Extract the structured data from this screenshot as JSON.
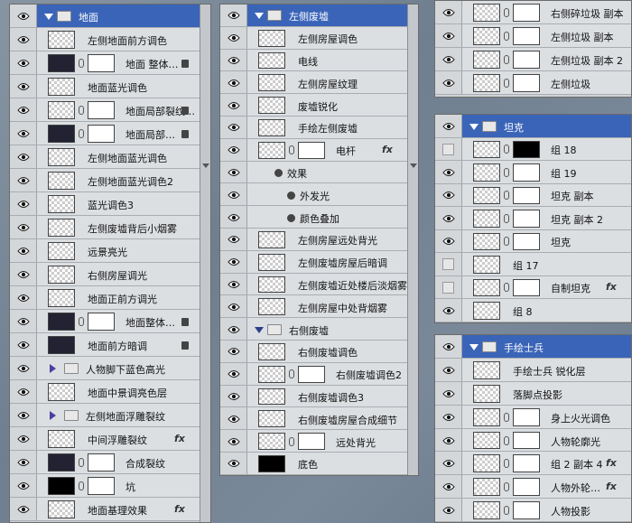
{
  "panel1": {
    "rows": [
      {
        "type": "group",
        "label": "地面"
      },
      {
        "type": "layer",
        "label": "左侧地面前方调色"
      },
      {
        "type": "masked",
        "label": "地面 整体…",
        "lock": true,
        "thumb": "dark"
      },
      {
        "type": "layer",
        "label": "地面蓝光调色"
      },
      {
        "type": "masked",
        "label": "地面局部裂纹…",
        "lock": true
      },
      {
        "type": "masked",
        "label": "地面局部…",
        "lock": true,
        "thumb": "dark"
      },
      {
        "type": "layer",
        "label": "左侧地面蓝光调色"
      },
      {
        "type": "layer",
        "label": "左侧地面蓝光调色2"
      },
      {
        "type": "layer",
        "label": "蓝光调色3"
      },
      {
        "type": "layer",
        "label": "左侧废墟背后小烟雾"
      },
      {
        "type": "layer",
        "label": "远景亮光"
      },
      {
        "type": "layer",
        "label": "右侧房屋调光"
      },
      {
        "type": "layer",
        "label": "地面正前方调光"
      },
      {
        "type": "masked",
        "label": "地面整体…",
        "lock": true,
        "thumb": "dark"
      },
      {
        "type": "layer",
        "label": "地面前方暗调",
        "lock": true,
        "thumb": "dark"
      },
      {
        "type": "subgroup",
        "label": "人物脚下蓝色高光"
      },
      {
        "type": "layer",
        "label": "地面中景调亮色层"
      },
      {
        "type": "subgroup",
        "label": "左侧地面浮雕裂纹"
      },
      {
        "type": "layer",
        "label": "中间浮雕裂纹",
        "fx": "fx"
      },
      {
        "type": "masked",
        "label": "合成裂纹",
        "thumb": "dark"
      },
      {
        "type": "masked",
        "label": "坑",
        "thumb": "black"
      },
      {
        "type": "layer",
        "label": "地面基理效果",
        "fx": "fx"
      }
    ]
  },
  "panel2": {
    "rows": [
      {
        "type": "group",
        "label": "左侧废墟"
      },
      {
        "type": "layer",
        "label": "左侧房屋调色"
      },
      {
        "type": "layer",
        "label": "电线"
      },
      {
        "type": "layer",
        "label": "左侧房屋纹理"
      },
      {
        "type": "layer",
        "label": "废墟锐化"
      },
      {
        "type": "layer",
        "label": "手绘左侧废墟"
      },
      {
        "type": "masked",
        "label": "电杆",
        "fx": "fx"
      },
      {
        "type": "effects",
        "label": "效果"
      },
      {
        "type": "effect",
        "label": "外发光"
      },
      {
        "type": "effect",
        "label": "颜色叠加"
      },
      {
        "type": "layer",
        "label": "左侧房屋远处背光"
      },
      {
        "type": "layer",
        "label": "左侧废墟房屋后暗调"
      },
      {
        "type": "layer",
        "label": "左侧废墟近处楼后淡烟雾"
      },
      {
        "type": "layer",
        "label": "左侧房屋中处背烟雾"
      },
      {
        "type": "group2",
        "label": "右侧废墟"
      },
      {
        "type": "layer",
        "label": "右侧废墟调色"
      },
      {
        "type": "masked",
        "label": "右侧废墟调色2"
      },
      {
        "type": "layer",
        "label": "右侧废墟调色3"
      },
      {
        "type": "layer",
        "label": "右侧废墟房屋合成细节"
      },
      {
        "type": "masked",
        "label": "远处背光"
      },
      {
        "type": "layer",
        "label": "底色",
        "thumb": "black"
      }
    ]
  },
  "panel3": {
    "rows": [
      {
        "type": "masked",
        "label": "右侧碎垃圾 副本"
      },
      {
        "type": "masked",
        "label": "左侧垃圾 副本"
      },
      {
        "type": "masked",
        "label": "左侧垃圾 副本 2"
      },
      {
        "type": "masked",
        "label": "左侧垃圾"
      }
    ]
  },
  "panel4": {
    "rows": [
      {
        "type": "group",
        "label": "坦克"
      },
      {
        "type": "masked",
        "label": "组 18",
        "eyeOff": true,
        "mask": "black"
      },
      {
        "type": "masked",
        "label": "组 19"
      },
      {
        "type": "masked",
        "label": "坦克 副本"
      },
      {
        "type": "masked",
        "label": "坦克 副本 2"
      },
      {
        "type": "masked",
        "label": "坦克"
      },
      {
        "type": "layer",
        "label": "组 17",
        "eyeOff": true
      },
      {
        "type": "masked",
        "label": "自制坦克",
        "eyeOff": true,
        "fx": "fx"
      },
      {
        "type": "layer",
        "label": "组 8"
      }
    ]
  },
  "panel5": {
    "rows": [
      {
        "type": "group",
        "label": "手绘士兵"
      },
      {
        "type": "layer",
        "label": "手绘士兵 锐化层"
      },
      {
        "type": "layer",
        "label": "落脚点投影"
      },
      {
        "type": "masked",
        "label": "身上火光调色"
      },
      {
        "type": "masked",
        "label": "人物轮廓光"
      },
      {
        "type": "masked",
        "label": "组 2 副本 4",
        "fx": "fx"
      },
      {
        "type": "masked",
        "label": "人物外轮…",
        "fx": "fx"
      },
      {
        "type": "masked",
        "label": "人物投影"
      }
    ]
  }
}
